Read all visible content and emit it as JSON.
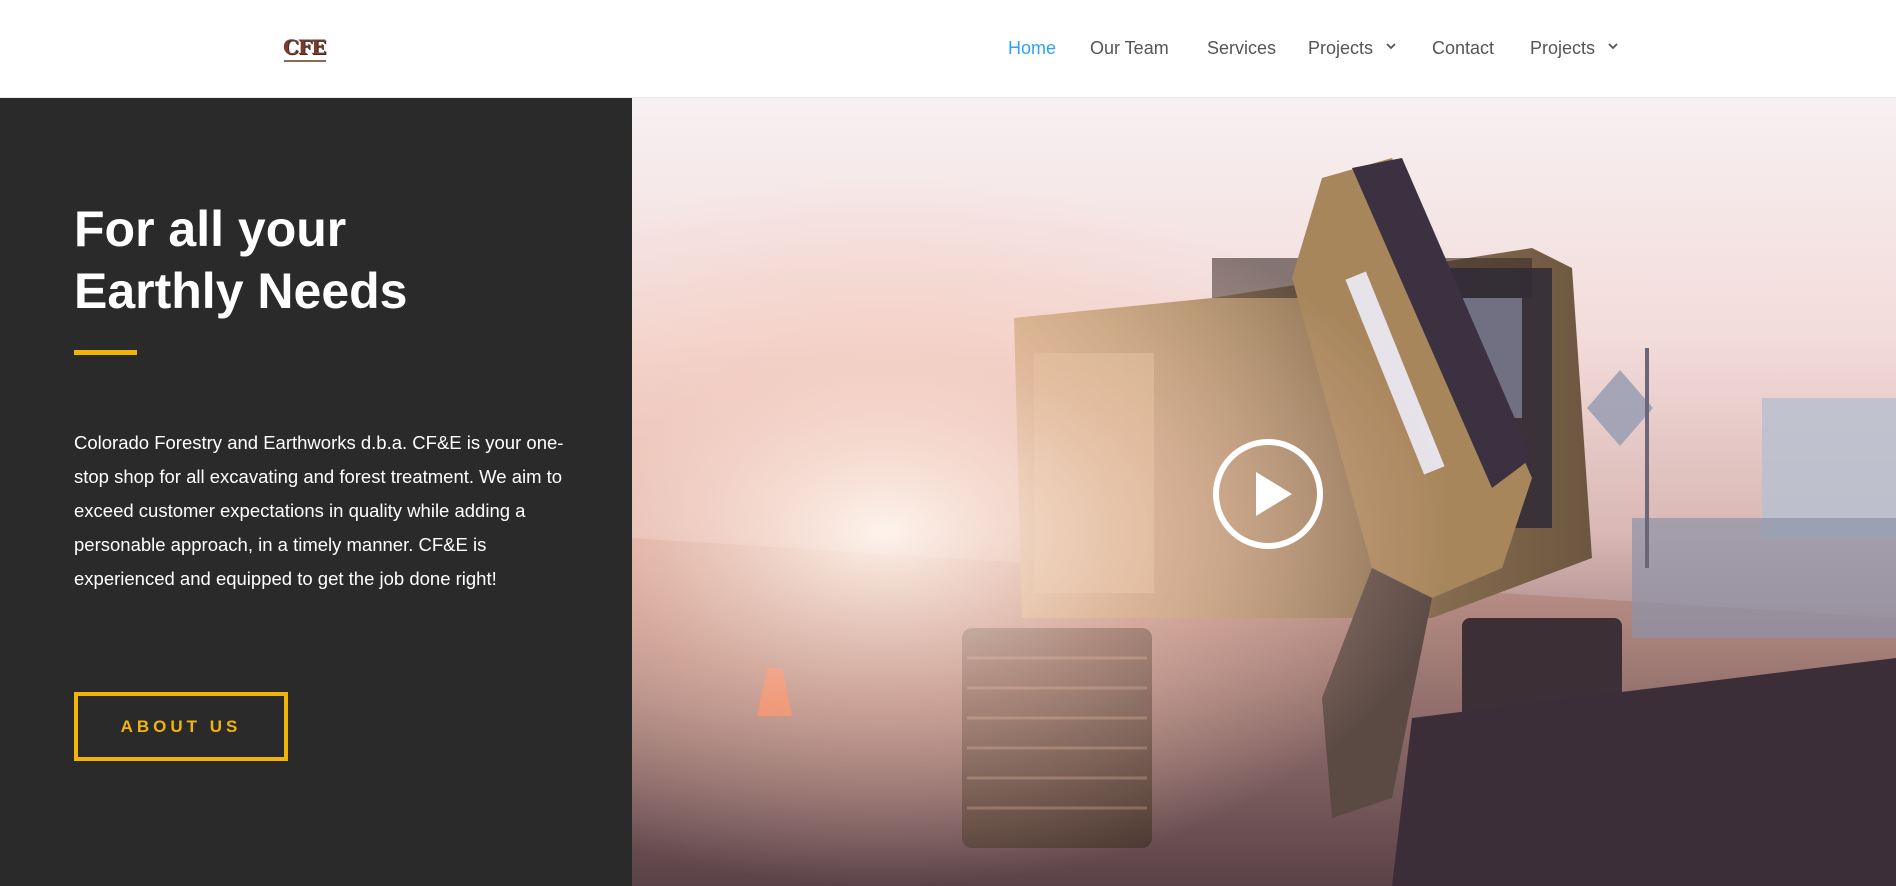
{
  "header": {
    "logo_text": "CFE",
    "nav": [
      {
        "label": "Home",
        "active": true,
        "dropdown": false
      },
      {
        "label": "Our Team",
        "active": false,
        "dropdown": false
      },
      {
        "label": "Services",
        "active": false,
        "dropdown": false
      },
      {
        "label": "Projects",
        "active": false,
        "dropdown": true
      },
      {
        "label": "Contact",
        "active": false,
        "dropdown": false
      },
      {
        "label": "Projects",
        "active": false,
        "dropdown": true
      }
    ]
  },
  "hero": {
    "headline_line1": "For all your",
    "headline_line2": "Earthly Needs",
    "intro": "Colorado Forestry and Earthworks d.b.a. CF&E is your one-stop shop for all excavating and forest treatment. We aim to exceed customer expectations in quality while adding a personable approach, in a timely manner. CF&E is experienced and equipped to get the job done right!",
    "cta_label": "ABOUT US"
  },
  "video": {
    "icon": "play-icon"
  },
  "colors": {
    "accent": "#f1b408",
    "nav_active": "#2ea3f2",
    "nav_text": "#555555",
    "panel_dark": "#2a2a2b"
  }
}
